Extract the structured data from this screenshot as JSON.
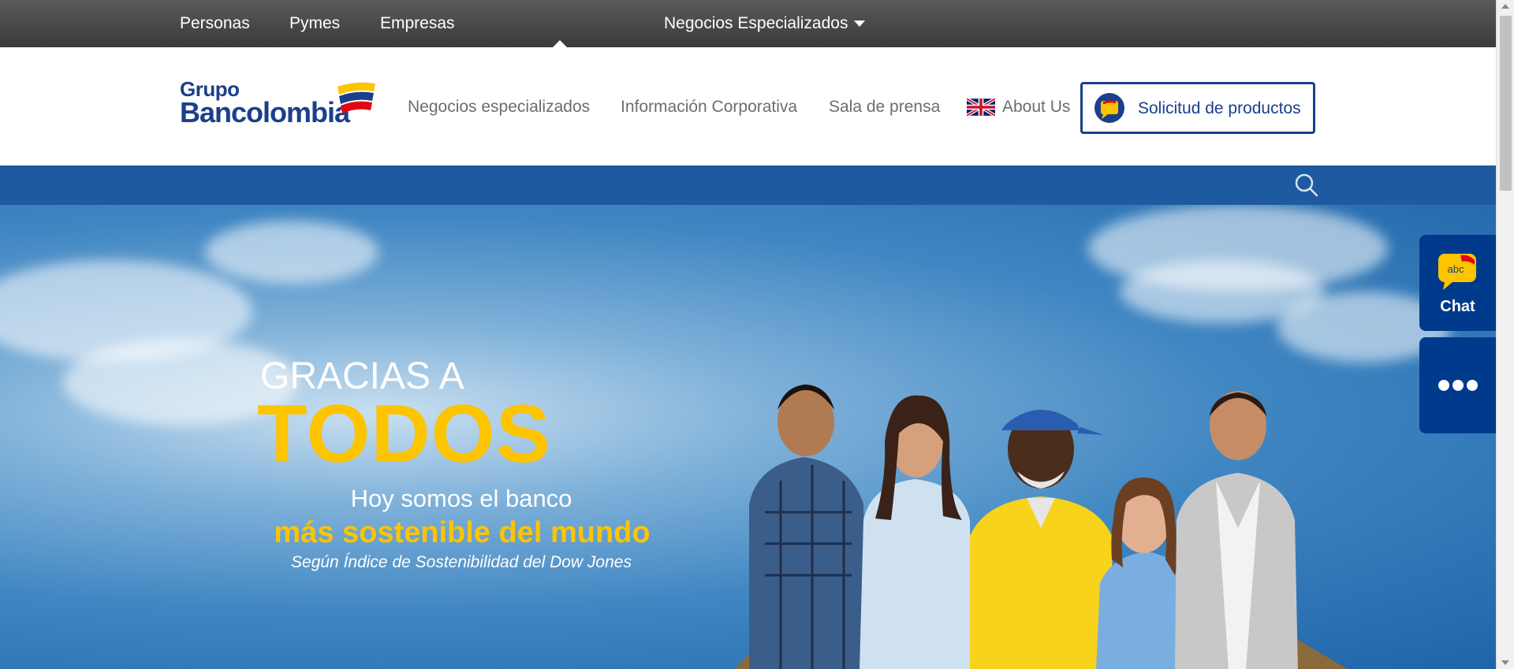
{
  "topbar": {
    "items": [
      {
        "label": "Personas"
      },
      {
        "label": "Pymes"
      },
      {
        "label": "Empresas"
      },
      {
        "label": "Negocios Especializados"
      }
    ]
  },
  "header": {
    "logo": {
      "line1": "Grupo",
      "line2": "Bancolombia"
    },
    "nav": [
      {
        "label": "Negocios especializados"
      },
      {
        "label": "Información Corporativa"
      },
      {
        "label": "Sala de prensa"
      },
      {
        "label": "About Us"
      }
    ],
    "cta": {
      "label": "Solicitud de productos"
    }
  },
  "hero": {
    "line1": "GRACIAS A",
    "line2": "TODOS",
    "line3": "Hoy somos el banco",
    "line4": "más sostenible del mundo",
    "line5": "Según Índice de Sostenibilidad del Dow Jones"
  },
  "widgets": {
    "chat": {
      "bubble_text": "abc",
      "label": "Chat"
    }
  },
  "colors": {
    "brand_blue": "#1b3f8b",
    "bar_blue": "#1e5aa0",
    "accent_yellow": "#fdc400",
    "widget_blue": "#003a8c"
  }
}
